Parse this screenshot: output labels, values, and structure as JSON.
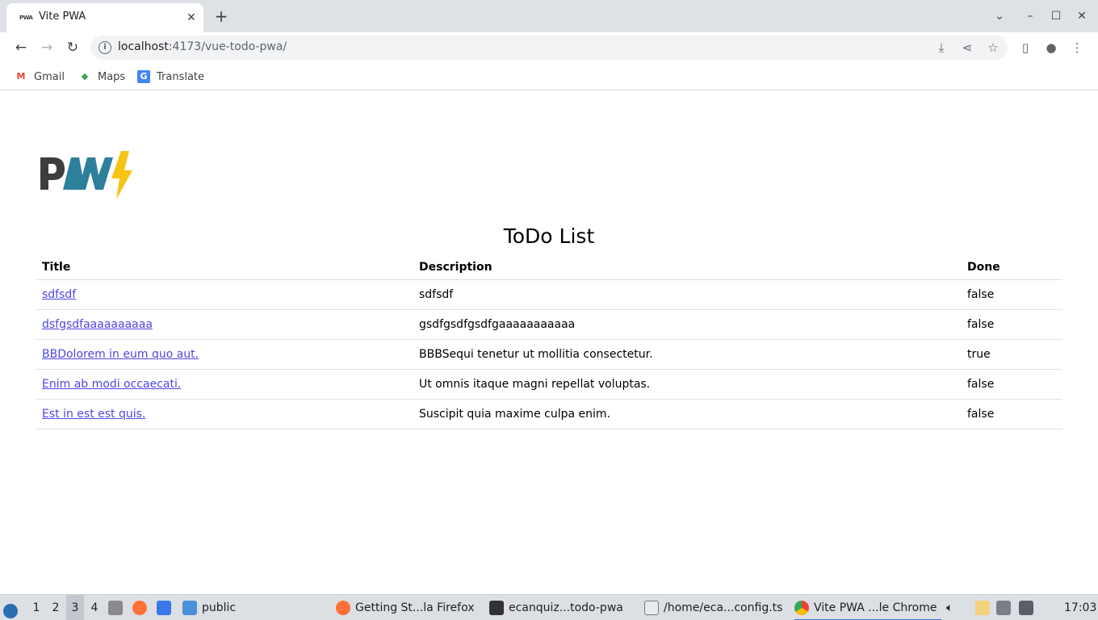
{
  "browser": {
    "tab_title": "Vite PWA",
    "tab_favicon_text": "PWA",
    "url_host": "localhost",
    "url_rest": ":4173/vue-todo-pwa/",
    "bookmarks": [
      {
        "label": "Gmail",
        "icon": "gmail-icon",
        "color": "#ea4335"
      },
      {
        "label": "Maps",
        "icon": "maps-icon",
        "color": "#34a853"
      },
      {
        "label": "Translate",
        "icon": "translate-icon",
        "color": "#4285f4"
      }
    ]
  },
  "page": {
    "logo_text": "PWA",
    "title": "ToDo List",
    "columns": [
      "Title",
      "Description",
      "Done"
    ],
    "rows": [
      {
        "title": "sdfsdf",
        "description": "sdfsdf",
        "done": "false"
      },
      {
        "title": "dsfgsdfaaaaaaaaaa",
        "description": "gsdfgsdfgsdfgaaaaaaaaaaa",
        "done": "false"
      },
      {
        "title": "BBDolorem in eum quo aut.",
        "description": "BBBSequi tenetur ut mollitia consectetur.",
        "done": "true"
      },
      {
        "title": "Enim ab modi occaecati.",
        "description": "Ut omnis itaque magni repellat voluptas.",
        "done": "false"
      },
      {
        "title": "Est in est est quis.",
        "description": "Suscipit quia maxime culpa enim.",
        "done": "false"
      }
    ],
    "link_color": "#4f46e5"
  },
  "taskbar": {
    "workspaces": [
      "1",
      "2",
      "3",
      "4"
    ],
    "active_workspace": "3",
    "folder_label": "public",
    "apps": [
      {
        "label": "Getting St...la Firefox",
        "icon": "firefox-icon"
      },
      {
        "label": "ecanquiz...todo-pwa",
        "icon": "terminal-icon"
      },
      {
        "label": "/home/eca...config.ts",
        "icon": "text-editor-icon"
      },
      {
        "label": "Vite PWA ...le Chrome",
        "icon": "chrome-icon"
      }
    ],
    "clock": "17:03"
  }
}
